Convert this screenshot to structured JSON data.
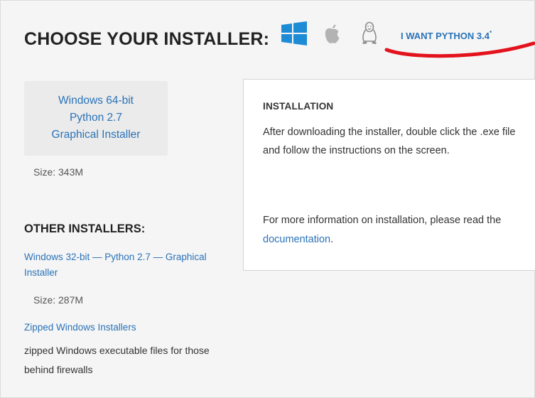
{
  "header": {
    "title": "CHOOSE YOUR INSTALLER:",
    "os_icons": [
      "windows-icon",
      "apple-icon",
      "linux-icon"
    ],
    "python_link": "I WANT PYTHON 3.4",
    "python_link_mark": "*"
  },
  "main_installer": {
    "line1": "Windows 64-bit",
    "line2": "Python 2.7",
    "line3": "Graphical Installer",
    "size": "Size: 343M"
  },
  "other_installers": {
    "title": "OTHER INSTALLERS:",
    "win32_link": "Windows 32-bit — Python 2.7 — Graphical Installer",
    "win32_size": "Size: 287M",
    "zipped_link": "Zipped Windows Installers",
    "zipped_desc": "zipped Windows executable files for those behind firewalls"
  },
  "installation": {
    "heading": "INSTALLATION",
    "text": "After downloading the installer, double click the .exe file and follow the instructions on the screen.",
    "more_prefix": "For more information on installation, please read the ",
    "more_link": "documentation",
    "more_suffix": "."
  },
  "colors": {
    "link": "#2a73b8",
    "annotation": "#e3121c",
    "background": "#f5f5f5"
  }
}
